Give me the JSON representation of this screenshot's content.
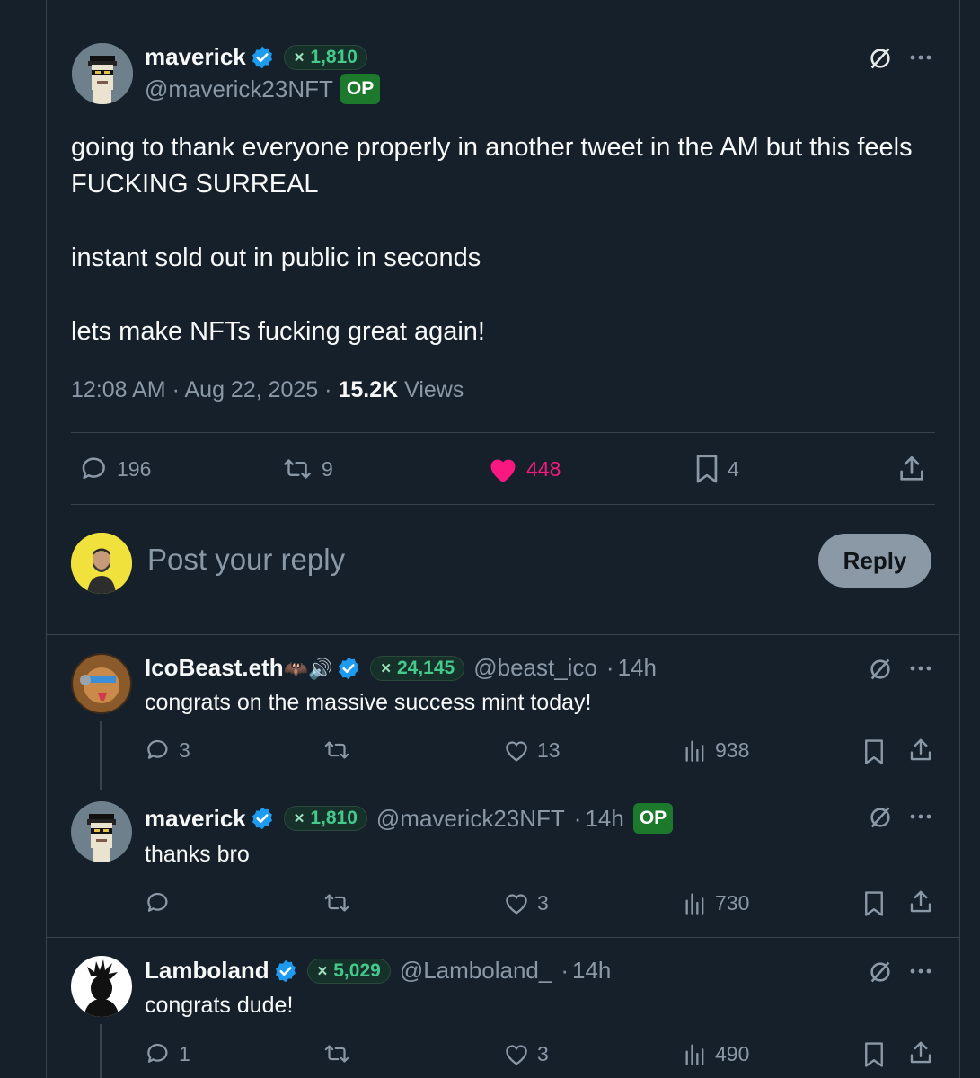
{
  "main_post": {
    "author_name": "maverick",
    "handle": "@maverick23NFT",
    "score": "1,810",
    "op_badge": "OP",
    "paragraphs": [
      "going to thank everyone properly in another tweet in the AM but this feels FUCKING SURREAL",
      "instant sold out in public in seconds",
      "lets make NFTs fucking great again!"
    ],
    "time": "12:08 AM",
    "date": "Aug 22, 2025",
    "views_count": "15.2K",
    "views_label": "Views",
    "replies": "196",
    "reposts": "9",
    "likes": "448",
    "bookmarks": "4"
  },
  "composer": {
    "placeholder": "Post your reply",
    "button_label": "Reply"
  },
  "replies": [
    {
      "author_name": "IcoBeast.eth",
      "author_emoji": "🦇🔊",
      "score": "24,145",
      "handle": "@beast_ico",
      "time": "14h",
      "text": "congrats on the massive success mint today!",
      "replies": "3",
      "reposts": "",
      "likes": "13",
      "views": "938"
    },
    {
      "author_name": "maverick",
      "score": "1,810",
      "handle": "@maverick23NFT",
      "time": "14h",
      "op_badge": "OP",
      "text": "thanks bro",
      "replies": "",
      "reposts": "",
      "likes": "3",
      "views": "730"
    },
    {
      "author_name": "Lamboland",
      "score": "5,029",
      "handle": "@Lamboland_",
      "time": "14h",
      "text": "congrats dude!",
      "replies": "1",
      "reposts": "",
      "likes": "3",
      "views": "490"
    }
  ],
  "colors": {
    "background": "#15202b",
    "accent_blue": "#1d9bf0",
    "like_pink": "#f91880",
    "op_green": "#1d7a2c",
    "score_green": "#45c98c"
  }
}
